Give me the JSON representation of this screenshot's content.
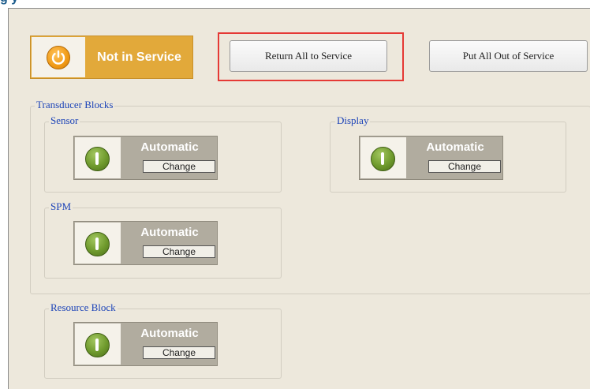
{
  "page": {
    "heading_fragment": "g                                                        y"
  },
  "status": {
    "label": "Not in Service",
    "icon": "power-icon",
    "color": "#e2a93a"
  },
  "toolbar": {
    "return_all_label": "Return All to Service",
    "put_all_out_label": "Put All Out of Service"
  },
  "transducer_blocks": {
    "title": "Transducer Blocks",
    "sensor": {
      "title": "Sensor",
      "mode": "Automatic",
      "change_label": "Change"
    },
    "display": {
      "title": "Display",
      "mode": "Automatic",
      "change_label": "Change"
    },
    "spm": {
      "title": "SPM",
      "mode": "Automatic",
      "change_label": "Change"
    }
  },
  "resource_block": {
    "title": "Resource Block",
    "mode": "Automatic",
    "change_label": "Change"
  },
  "colors": {
    "accent_orange": "#e2a93a",
    "highlight_red": "#e53935",
    "legend_blue": "#1d44b8",
    "ok_green": "#6f9a2d"
  }
}
